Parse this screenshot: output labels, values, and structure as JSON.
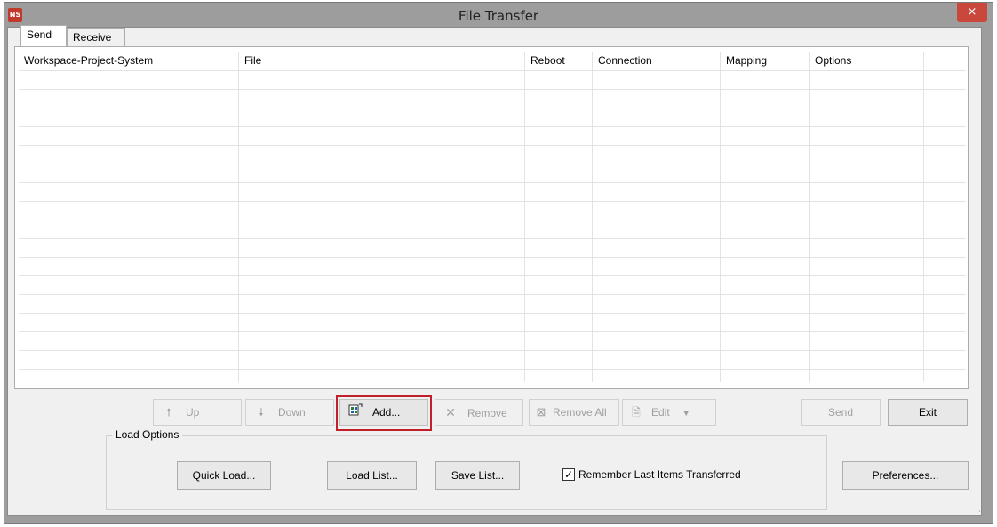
{
  "window": {
    "title": "File Transfer",
    "icon_text": "NS",
    "close_label": "×"
  },
  "tabs": [
    {
      "label": "Send",
      "selected": true
    },
    {
      "label": "Receive",
      "selected": false
    }
  ],
  "grid": {
    "columns": [
      "Workspace-Project-System",
      "File",
      "Reboot",
      "Connection",
      "Mapping",
      "Options"
    ],
    "rows": []
  },
  "toolbar": {
    "up_label": "Up",
    "down_label": "Down",
    "add_label": "Add...",
    "remove_label": "Remove",
    "remove_all_label": "Remove All",
    "edit_label": "Edit",
    "send_label": "Send",
    "exit_label": "Exit"
  },
  "load_options": {
    "group_label": "Load Options",
    "quick_load_label": "Quick Load...",
    "load_list_label": "Load List...",
    "save_list_label": "Save List...",
    "remember_label": "Remember Last Items Transferred",
    "remember_checked": true
  },
  "preferences_label": "Preferences...",
  "colors": {
    "highlight": "#c0202a",
    "close_button": "#c9483b"
  }
}
